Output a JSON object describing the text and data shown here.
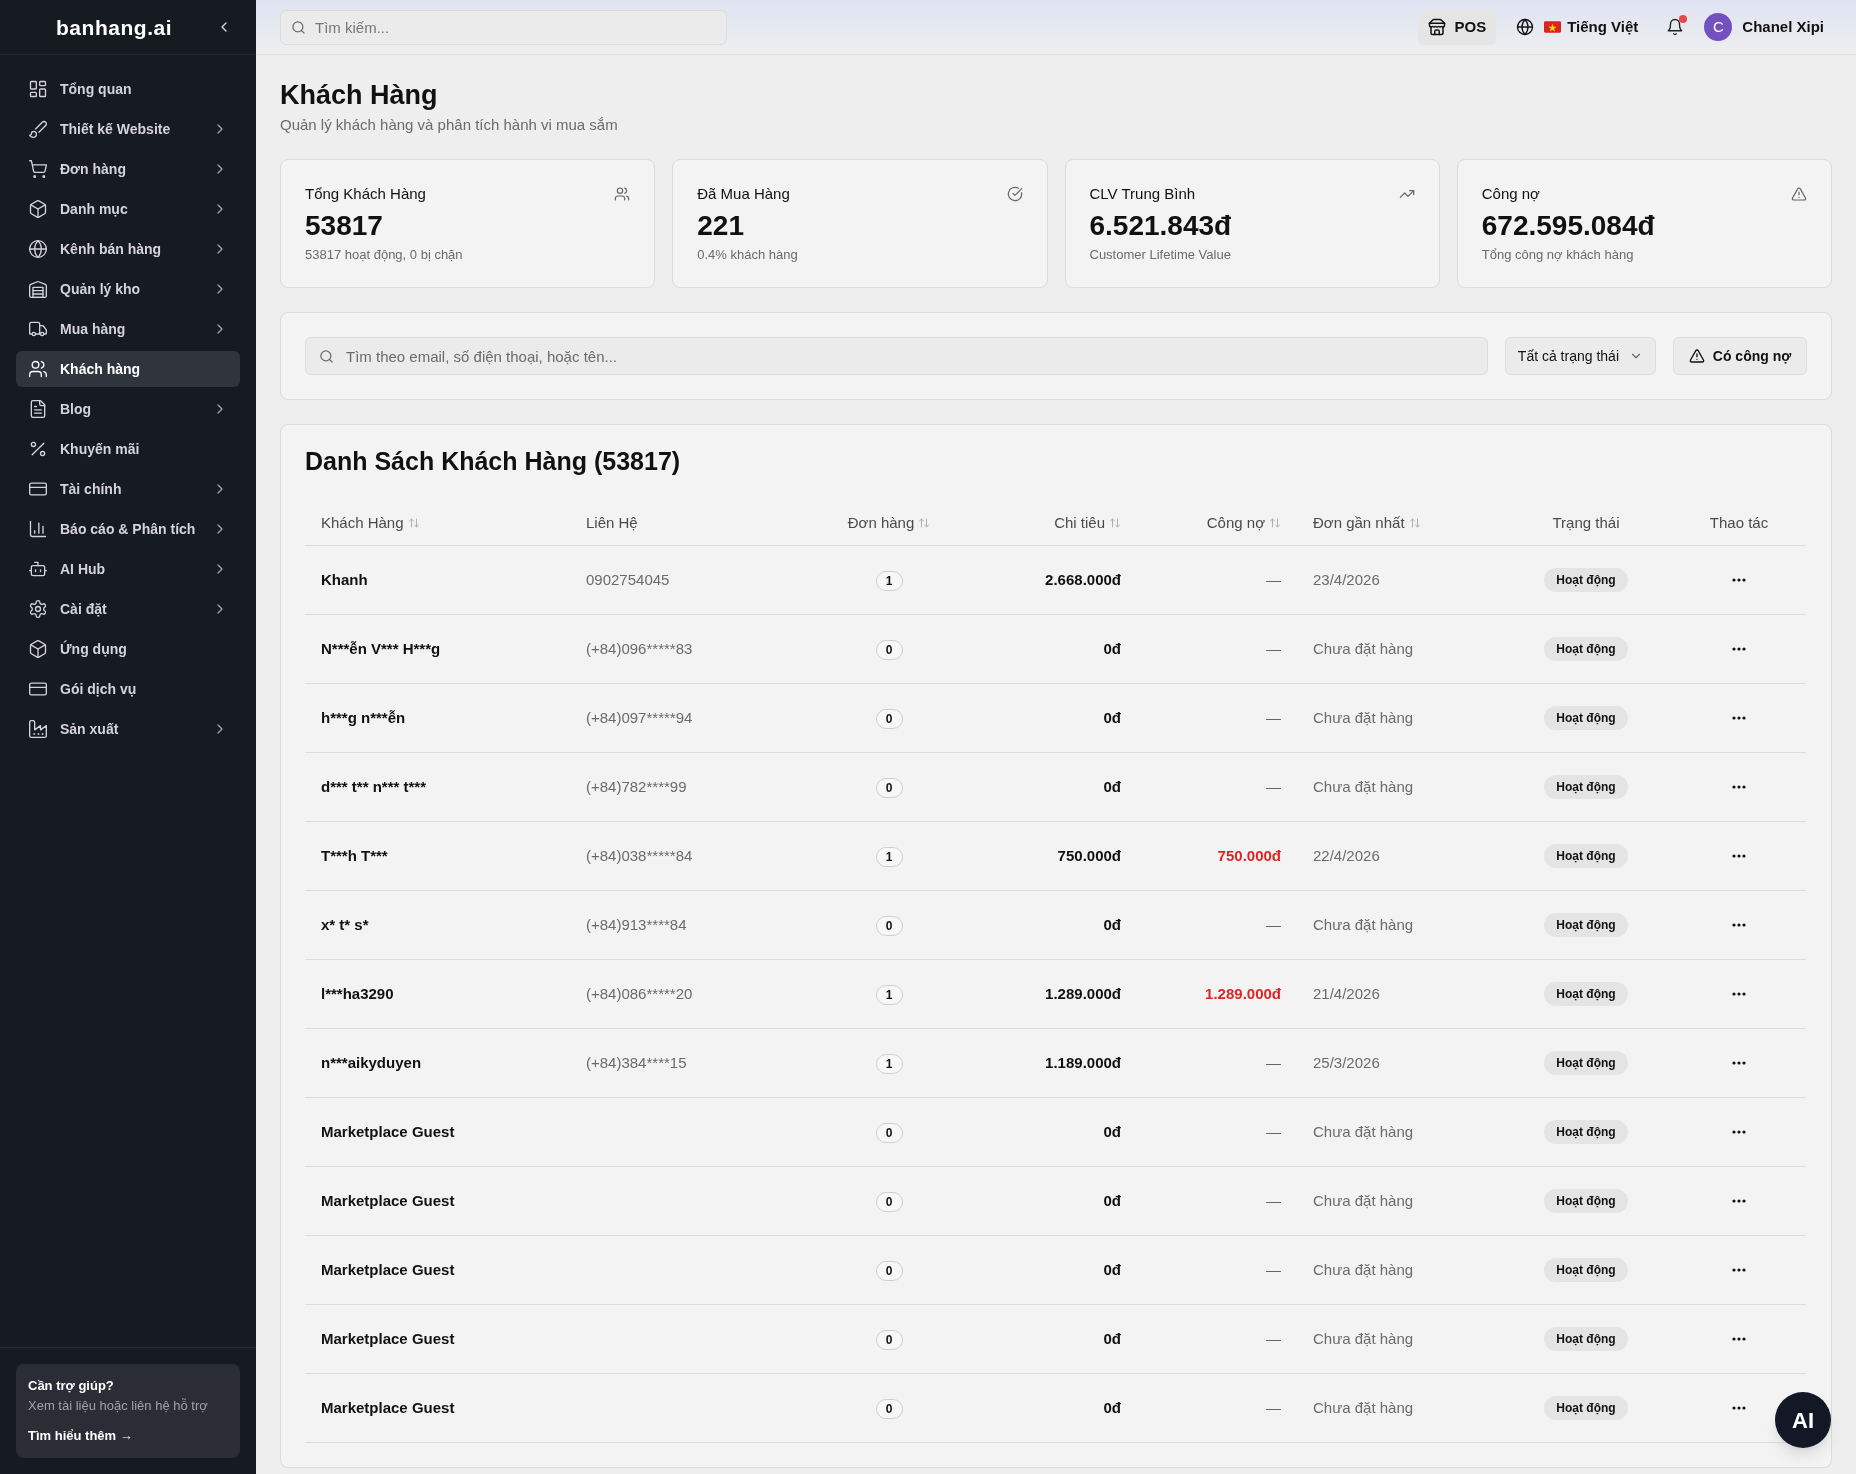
{
  "sidebar": {
    "logo": "banhang.ai",
    "items": [
      {
        "label": "Tổng quan",
        "expandable": false,
        "selected": false
      },
      {
        "label": "Thiết kế Website",
        "expandable": true,
        "selected": false
      },
      {
        "label": "Đơn hàng",
        "expandable": true,
        "selected": false
      },
      {
        "label": "Danh mục",
        "expandable": true,
        "selected": false
      },
      {
        "label": "Kênh bán hàng",
        "expandable": true,
        "selected": false
      },
      {
        "label": "Quản lý kho",
        "expandable": true,
        "selected": false
      },
      {
        "label": "Mua hàng",
        "expandable": true,
        "selected": false
      },
      {
        "label": "Khách hàng",
        "expandable": false,
        "selected": true
      },
      {
        "label": "Blog",
        "expandable": true,
        "selected": false
      },
      {
        "label": "Khuyến mãi",
        "expandable": false,
        "selected": false
      },
      {
        "label": "Tài chính",
        "expandable": true,
        "selected": false
      },
      {
        "label": "Báo cáo & Phân tích",
        "expandable": true,
        "selected": false
      },
      {
        "label": "AI Hub",
        "expandable": true,
        "selected": false
      },
      {
        "label": "Cài đặt",
        "expandable": true,
        "selected": false
      },
      {
        "label": "Ứng dụng",
        "expandable": false,
        "selected": false
      },
      {
        "label": "Gói dịch vụ",
        "expandable": false,
        "selected": false
      },
      {
        "label": "Sản xuất",
        "expandable": true,
        "selected": false
      }
    ],
    "help": {
      "title": "Cần trợ giúp?",
      "text": "Xem tài liệu hoặc liên hệ hỗ trợ",
      "link": "Tìm hiểu thêm →"
    }
  },
  "topbar": {
    "search": {
      "placeholder": "Tìm kiếm..."
    },
    "pos_button": "POS",
    "language": "Tiếng Việt",
    "notifications": {
      "unread": true
    },
    "user": {
      "initial": "C",
      "name": "Chanel Xipi"
    }
  },
  "page": {
    "title": "Khách Hàng",
    "subtitle": "Quản lý khách hàng và phân tích hành vi mua sắm"
  },
  "stats": [
    {
      "label": "Tổng Khách Hàng",
      "value": "53817",
      "note": "53817 hoạt động, 0 bị chặn"
    },
    {
      "label": "Đã Mua Hàng",
      "value": "221",
      "note": "0.4% khách hàng"
    },
    {
      "label": "CLV Trung Bình",
      "value": "6.521.843đ",
      "note": "Customer Lifetime Value"
    },
    {
      "label": "Công nợ",
      "value": "672.595.084đ",
      "note": "Tổng công nợ khách hàng"
    }
  ],
  "filters": {
    "search": {
      "placeholder": "Tìm theo email, số điện thoại, hoặc tên..."
    },
    "status_select": "Tất cả trạng thái",
    "debt_button": "Có công nợ"
  },
  "table": {
    "title": "Danh Sách Khách Hàng (53817)",
    "columns": [
      {
        "label": "Khách Hàng",
        "sortable": true
      },
      {
        "label": "Liên Hệ",
        "sortable": false
      },
      {
        "label": "Đơn hàng",
        "sortable": true
      },
      {
        "label": "Chi tiêu",
        "sortable": true
      },
      {
        "label": "Công nợ",
        "sortable": true
      },
      {
        "label": "Đơn gần nhất",
        "sortable": true
      },
      {
        "label": "Trạng thái",
        "sortable": false
      },
      {
        "label": "Thao tác",
        "sortable": false
      }
    ],
    "rows": [
      {
        "name": "Khanh",
        "contact": "0902754045",
        "orders": "1",
        "spent": "2.668.000đ",
        "debt": "—",
        "has_debt": false,
        "last_order": "23/4/2026",
        "status": "Hoạt động"
      },
      {
        "name": "N***ễn V*** H***g",
        "contact": "(+84)096*****83",
        "orders": "0",
        "spent": "0đ",
        "debt": "—",
        "has_debt": false,
        "last_order": "Chưa đặt hàng",
        "status": "Hoạt động"
      },
      {
        "name": "h***g n***ễn",
        "contact": "(+84)097*****94",
        "orders": "0",
        "spent": "0đ",
        "debt": "—",
        "has_debt": false,
        "last_order": "Chưa đặt hàng",
        "status": "Hoạt động"
      },
      {
        "name": "d*** t** n*** t***",
        "contact": "(+84)782****99",
        "orders": "0",
        "spent": "0đ",
        "debt": "—",
        "has_debt": false,
        "last_order": "Chưa đặt hàng",
        "status": "Hoạt động"
      },
      {
        "name": "T***h T***",
        "contact": "(+84)038*****84",
        "orders": "1",
        "spent": "750.000đ",
        "debt": "750.000đ",
        "has_debt": true,
        "last_order": "22/4/2026",
        "status": "Hoạt động"
      },
      {
        "name": "x* t* s*",
        "contact": "(+84)913****84",
        "orders": "0",
        "spent": "0đ",
        "debt": "—",
        "has_debt": false,
        "last_order": "Chưa đặt hàng",
        "status": "Hoạt động"
      },
      {
        "name": "l***ha3290",
        "contact": "(+84)086*****20",
        "orders": "1",
        "spent": "1.289.000đ",
        "debt": "1.289.000đ",
        "has_debt": true,
        "last_order": "21/4/2026",
        "status": "Hoạt động"
      },
      {
        "name": "n***aikyduyen",
        "contact": "(+84)384****15",
        "orders": "1",
        "spent": "1.189.000đ",
        "debt": "—",
        "has_debt": false,
        "last_order": "25/3/2026",
        "status": "Hoạt động"
      },
      {
        "name": "Marketplace Guest",
        "orders": "0",
        "spent": "0đ",
        "debt": "—",
        "has_debt": false,
        "last_order": "Chưa đặt hàng",
        "status": "Hoạt động"
      },
      {
        "name": "Marketplace Guest",
        "orders": "0",
        "spent": "0đ",
        "debt": "—",
        "has_debt": false,
        "last_order": "Chưa đặt hàng",
        "status": "Hoạt động"
      },
      {
        "name": "Marketplace Guest",
        "orders": "0",
        "spent": "0đ",
        "debt": "—",
        "has_debt": false,
        "last_order": "Chưa đặt hàng",
        "status": "Hoạt động"
      },
      {
        "name": "Marketplace Guest",
        "orders": "0",
        "spent": "0đ",
        "debt": "—",
        "has_debt": false,
        "last_order": "Chưa đặt hàng",
        "status": "Hoạt động"
      },
      {
        "name": "Marketplace Guest",
        "orders": "0",
        "spent": "0đ",
        "debt": "—",
        "has_debt": false,
        "last_order": "Chưa đặt hàng",
        "status": "Hoạt động"
      }
    ]
  },
  "ai_button": "AI"
}
